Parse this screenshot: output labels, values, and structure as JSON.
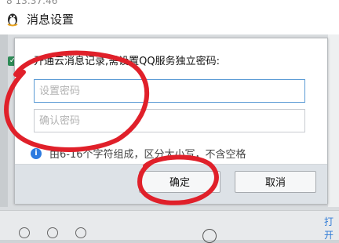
{
  "status_time": "8 13:37:46",
  "window": {
    "title": "消息设置",
    "icon": "qq-penguin-icon"
  },
  "dialog": {
    "prompt": "开通云消息记录,需设置QQ服务独立密码:",
    "password_placeholder": "设置密码",
    "confirm_placeholder": "确认密码",
    "hint": "由6-16个字符组成，区分大小写，不含空格",
    "ok_label": "确定",
    "cancel_label": "取消"
  },
  "background": {
    "open_link": "打开"
  },
  "colors": {
    "annotation": "#e0202a",
    "accent": "#2d7be0",
    "footer": "#dde2e7"
  }
}
